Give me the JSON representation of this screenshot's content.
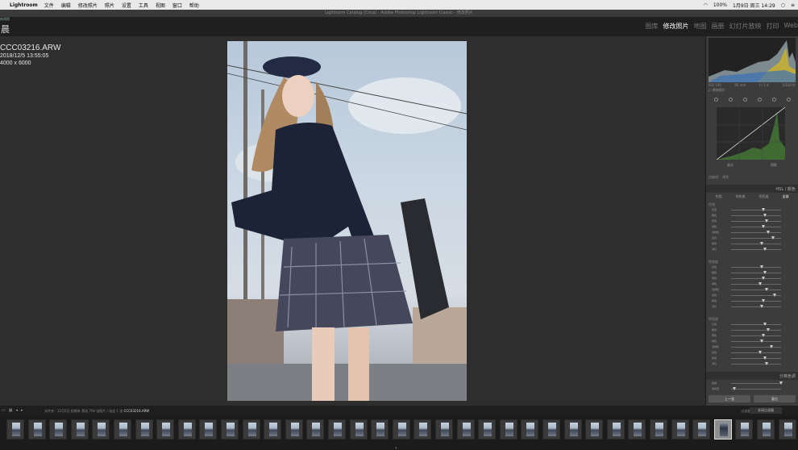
{
  "menubar": {
    "app": "Lightroom",
    "items": [
      "文件",
      "编辑",
      "修改照片",
      "照片",
      "设置",
      "工具",
      "视图",
      "窗口",
      "帮助"
    ],
    "right": {
      "battery": "100%",
      "date_time": "1月9日 周三 14:29"
    }
  },
  "titlebar": {
    "title": "Lightroom Catalog (Circa) - Adobe Photoshop Lightroom Classic - 修改照片"
  },
  "modulebar": {
    "identity_small": "修改照",
    "identity": "晨",
    "modules": [
      "图库",
      "修改照片",
      "地图",
      "画册",
      "幻灯片放映",
      "打印",
      "Web"
    ],
    "active_index": 1
  },
  "photo_info": {
    "filename": "CCC03216.ARW",
    "datetime": "2018/12/5 13:55:05",
    "dimensions": "4000 x 6000"
  },
  "right_panel": {
    "histogram_info": {
      "iso": "ISO 100",
      "lens": "85 mm",
      "aperture": "f / 1.4",
      "shutter": "1/320 秒"
    },
    "original_photo_label": "原始照片",
    "curve_labels": {
      "left": "高光",
      "right": "阴影"
    },
    "channel_label": "点曲线：  线性",
    "hsl_title": "HSL / 颜色",
    "hsl_tabs": [
      "色相",
      "饱和度",
      "明亮度",
      "全部"
    ],
    "hsl_active": 3,
    "groups": [
      {
        "title": "色相",
        "rows": [
          "红色",
          "橙色",
          "黄色",
          "绿色",
          "浅绿色",
          "蓝色",
          "紫色",
          "洋红"
        ]
      },
      {
        "title": "饱和度",
        "rows": [
          "红色",
          "橙色",
          "黄色",
          "绿色",
          "浅绿色",
          "蓝色",
          "紫色",
          "洋红"
        ]
      },
      {
        "title": "明亮度",
        "rows": [
          "红色",
          "橙色",
          "黄色",
          "绿色",
          "浅绿色",
          "蓝色",
          "紫色",
          "洋红"
        ]
      }
    ],
    "split_toning_title": "分离色调",
    "mini_sliders": [
      "色相",
      "饱和度"
    ],
    "buttons": {
      "previous": "上一张",
      "reset": "复位"
    }
  },
  "filmbar": {
    "path_prefix": "文件夹 : 12月5日 前期未 筛选",
    "path_count": "706 张照片 / 选定 1 张",
    "current_file": "CCC03216.ARW",
    "filter_label": "过滤器 :",
    "no_filter_label": "关闭过滤器"
  },
  "filmstrip": {
    "thumbnail_count": 37,
    "selected_index": 33
  }
}
